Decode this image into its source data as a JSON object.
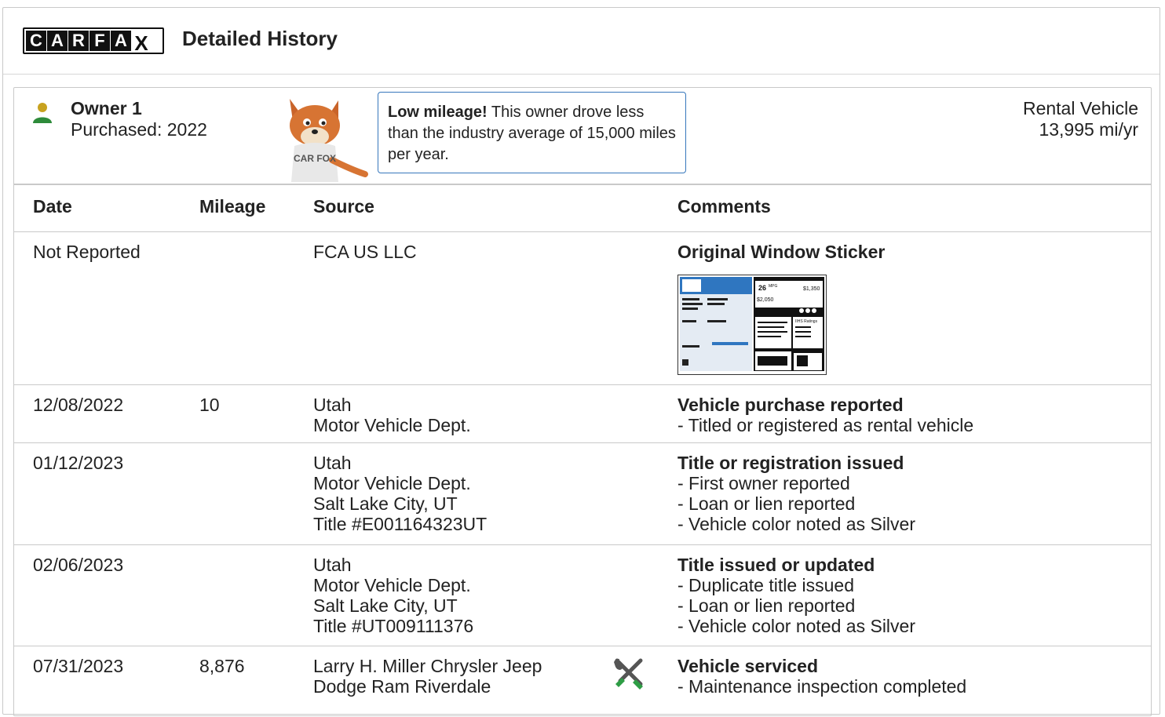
{
  "header": {
    "logo_letters": [
      "C",
      "A",
      "R",
      "F",
      "A",
      "X"
    ],
    "title": "Detailed History"
  },
  "owner": {
    "name": "Owner 1",
    "purchased": "Purchased: 2022",
    "callout_bold": "Low mileage!",
    "callout_text": " This owner drove less than the industry average of 15,000 miles per year.",
    "usage_type": "Rental Vehicle",
    "usage_miles": "13,995 mi/yr",
    "fox_shirt_text": "CAR FOX"
  },
  "table": {
    "columns": [
      "Date",
      "Mileage",
      "Source",
      "Comments"
    ],
    "rows": [
      {
        "date": "Not Reported",
        "mileage": "",
        "source": [
          "FCA US LLC"
        ],
        "comment_title": "Original Window Sticker",
        "details": [],
        "sticker_text": {
          "mpg": "26",
          "mpg_unit": "MPG",
          "cost1": "$2,050",
          "cost2": "$1,350",
          "ratings": "IIHS Ratings"
        }
      },
      {
        "date": "12/08/2022",
        "mileage": "10",
        "source": [
          "Utah",
          "Motor Vehicle Dept."
        ],
        "comment_title": "Vehicle purchase reported",
        "details": [
          "- Titled or registered as rental vehicle"
        ]
      },
      {
        "date": "01/12/2023",
        "mileage": "",
        "source": [
          "Utah",
          "Motor Vehicle Dept.",
          "Salt Lake City, UT",
          "Title #E001164323UT"
        ],
        "comment_title": "Title or registration issued",
        "details": [
          "- First owner reported",
          "- Loan or lien reported",
          "- Vehicle color noted as Silver"
        ]
      },
      {
        "date": "02/06/2023",
        "mileage": "",
        "source": [
          "Utah",
          "Motor Vehicle Dept.",
          "Salt Lake City, UT",
          "Title #UT009111376"
        ],
        "comment_title": "Title issued or updated",
        "details": [
          "- Duplicate title issued",
          "- Loan or lien reported",
          "- Vehicle color noted as Silver"
        ]
      },
      {
        "date": "07/31/2023",
        "mileage": "8,876",
        "source": [
          "Larry H. Miller Chrysler Jeep",
          "Dodge Ram Riverdale"
        ],
        "comment_title": "Vehicle serviced",
        "details": [
          "- Maintenance inspection completed"
        ],
        "icon": "wrench-screwdriver-icon"
      }
    ]
  },
  "colors": {
    "accent_blue": "#3777bc",
    "owner_head": "#c8a21f",
    "owner_body": "#2e8b3a",
    "service_green": "#2e9d45",
    "border": "#c9c9c9"
  }
}
